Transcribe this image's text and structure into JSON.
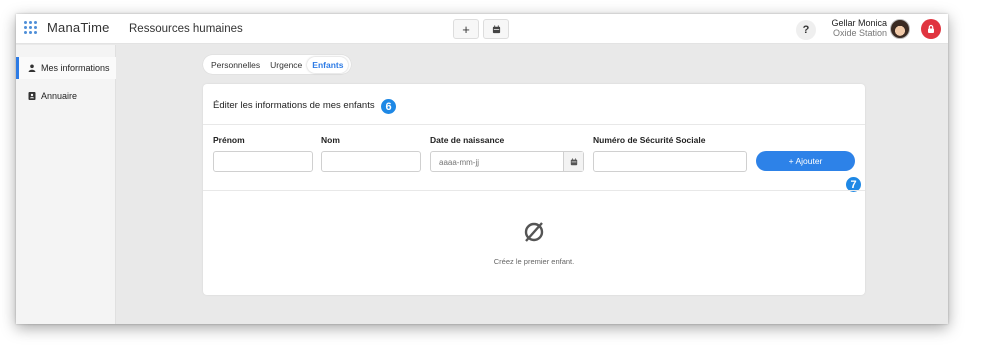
{
  "app": {
    "logo_text": "ManaTime",
    "module_title": "Ressources humaines",
    "top_buttons": [
      "+",
      "calendar-icon"
    ],
    "help_label": "?",
    "user": {
      "name": "Gellar Monica",
      "company": "Oxide Station"
    }
  },
  "sidebar": {
    "items": [
      {
        "label": "Mes informations",
        "icon": "user-icon",
        "active": true
      },
      {
        "label": "Annuaire",
        "icon": "contact-book-icon",
        "active": false
      }
    ]
  },
  "tabs": [
    {
      "label": "Personnelles",
      "active": false
    },
    {
      "label": "Urgence",
      "active": false
    },
    {
      "label": "Enfants",
      "active": true
    }
  ],
  "card": {
    "title": "Éditer les informations de mes enfants",
    "badges": [
      "6",
      "7"
    ],
    "fields": {
      "prenom": {
        "label": "Prénom",
        "value": "",
        "placeholder": ""
      },
      "nom": {
        "label": "Nom",
        "value": "",
        "placeholder": ""
      },
      "date": {
        "label": "Date de naissance",
        "value": "",
        "placeholder": "aaaa-mm-jj"
      },
      "nss": {
        "label": "Numéro de Sécurité Sociale",
        "value": "",
        "placeholder": ""
      }
    },
    "add_button": "+ Ajouter",
    "empty_icon": "∅",
    "empty_text": "Créez le premier enfant."
  },
  "colors": {
    "accent": "#2d82e8",
    "badge": "#1e88e5",
    "logout": "#e0343f"
  }
}
